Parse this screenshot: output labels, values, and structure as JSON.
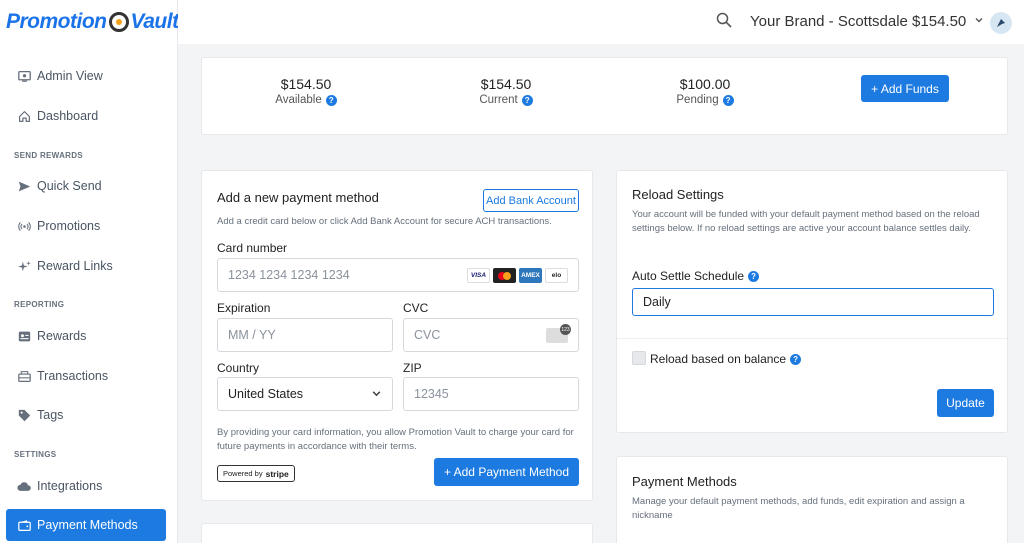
{
  "app": {
    "logo_left": "Promotion",
    "logo_right": "Vault"
  },
  "sidebar": {
    "items": [
      {
        "label": "Admin View",
        "icon": "admin-icon"
      },
      {
        "label": "Dashboard",
        "icon": "home-icon"
      },
      {
        "label": "Quick Send",
        "icon": "send-icon"
      },
      {
        "label": "Promotions",
        "icon": "broadcast-icon"
      },
      {
        "label": "Reward Links",
        "icon": "sparkle-icon"
      },
      {
        "label": "Rewards",
        "icon": "id-card-icon"
      },
      {
        "label": "Transactions",
        "icon": "register-icon"
      },
      {
        "label": "Tags",
        "icon": "tag-icon"
      },
      {
        "label": "Integrations",
        "icon": "cloud-icon"
      },
      {
        "label": "Payment Methods",
        "icon": "wallet-icon",
        "active": true
      }
    ],
    "sections": [
      "SEND REWARDS",
      "REPORTING",
      "SETTINGS"
    ]
  },
  "topbar": {
    "brand_label": "Your Brand - Scottsdale $154.50"
  },
  "balance": {
    "available_amount": "$154.50",
    "available_label": "Available",
    "current_amount": "$154.50",
    "current_label": "Current",
    "pending_amount": "$100.00",
    "pending_label": "Pending",
    "add_funds_label": "+ Add Funds"
  },
  "payment_form": {
    "title": "Add a new payment method",
    "add_bank_label": "Add Bank Account",
    "description": "Add a credit card below or click Add Bank Account for secure ACH transactions.",
    "card_number_label": "Card number",
    "card_number_placeholder": "1234 1234 1234 1234",
    "expiration_label": "Expiration",
    "expiration_placeholder": "MM / YY",
    "cvc_label": "CVC",
    "cvc_placeholder": "CVC",
    "country_label": "Country",
    "country_value": "United States",
    "zip_label": "ZIP",
    "zip_placeholder": "12345",
    "terms": "By providing your card information, you allow Promotion Vault to charge your card for future payments in accordance with their terms.",
    "powered_by": "Powered by",
    "stripe": "stripe",
    "submit_label": "+ Add Payment Method",
    "card_brands": [
      "VISA",
      "AMEX",
      "elo"
    ]
  },
  "reload": {
    "title": "Reload Settings",
    "description": "Your account will be funded with your default payment method based on the reload settings below. If no reload settings are active your account balance settles daily.",
    "schedule_label": "Auto Settle Schedule",
    "schedule_value": "Daily",
    "balance_checkbox_label": "Reload based on balance",
    "update_label": "Update"
  },
  "payment_methods": {
    "title": "Payment Methods",
    "description": "Manage your default payment methods, add funds, edit expiration and assign a nickname"
  },
  "colors": {
    "accent": "#1c7ae0",
    "background": "#f3f4f6"
  }
}
